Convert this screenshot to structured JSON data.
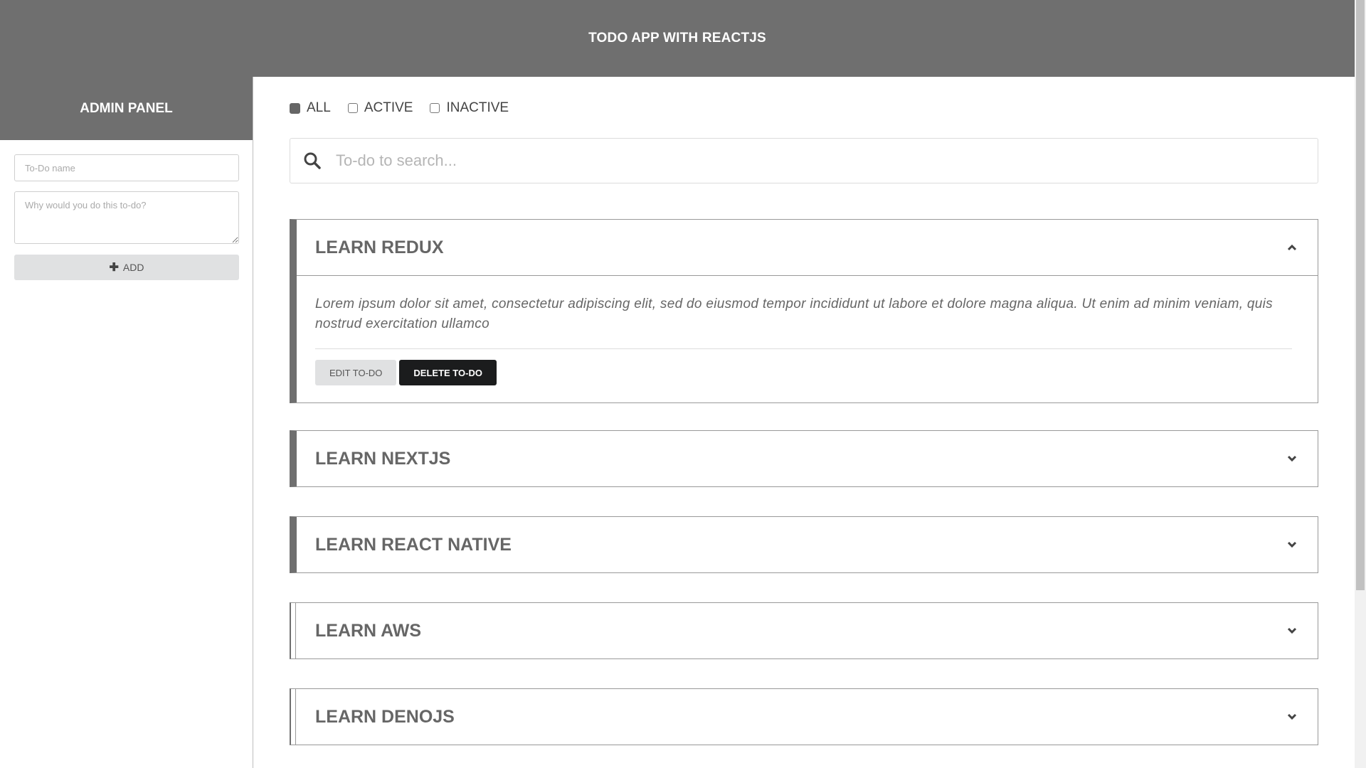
{
  "header": {
    "title": "TODO APP WITH REACTJS"
  },
  "sidebar": {
    "title": "ADMIN PANEL",
    "name_placeholder": "To-Do name",
    "reason_placeholder": "Why would you do this to-do?",
    "add_label": "ADD"
  },
  "filters": {
    "all": "ALL",
    "active": "ACTIVE",
    "inactive": "INACTIVE",
    "selected": "ALL"
  },
  "search": {
    "placeholder": "To-do to search..."
  },
  "todos": [
    {
      "title": "LEARN REDUX",
      "expanded": true,
      "active": true,
      "description": "Lorem ipsum dolor sit amet, consectetur adipiscing elit, sed do eiusmod tempor incididunt ut labore et dolore magna aliqua. Ut enim ad minim veniam, quis nostrud exercitation ullamco",
      "edit_label": "EDIT TO-DO",
      "delete_label": "DELETE TO-DO"
    },
    {
      "title": "LEARN NEXTJS",
      "expanded": false,
      "active": true
    },
    {
      "title": "LEARN REACT NATIVE",
      "expanded": false,
      "active": true
    },
    {
      "title": "LEARN AWS",
      "expanded": false,
      "active": false
    },
    {
      "title": "LEARN DENOJS",
      "expanded": false,
      "active": false
    }
  ],
  "colors": {
    "header_bg": "#6f6f6f",
    "accent_dark": "#1b1c1d",
    "button_grey": "#e0e1e2"
  },
  "icons": {
    "add": "plus-icon",
    "search": "search-icon",
    "expanded": "chevron-up-icon",
    "collapsed": "chevron-down-icon"
  }
}
